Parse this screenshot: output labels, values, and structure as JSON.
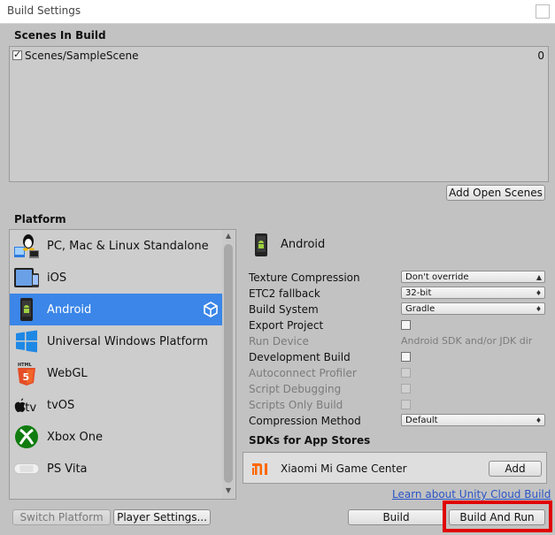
{
  "window": {
    "title": "Build Settings"
  },
  "scenes": {
    "header": "Scenes In Build",
    "items": [
      {
        "name": "Scenes/SampleScene",
        "index": "0",
        "checked": true
      }
    ],
    "add_open_scenes_label": "Add Open Scenes"
  },
  "platform": {
    "header": "Platform",
    "items": [
      {
        "label": "PC, Mac & Linux Standalone",
        "icon": "pc-mac-linux-icon"
      },
      {
        "label": "iOS",
        "icon": "ios-icon"
      },
      {
        "label": "Android",
        "icon": "android-icon",
        "selected": true
      },
      {
        "label": "Universal Windows Platform",
        "icon": "windows-icon"
      },
      {
        "label": "WebGL",
        "icon": "html5-icon"
      },
      {
        "label": "tvOS",
        "icon": "apple-tv-icon"
      },
      {
        "label": "Xbox One",
        "icon": "xbox-icon"
      },
      {
        "label": "PS Vita",
        "icon": "ps-vita-icon"
      }
    ],
    "selected_label": "Android"
  },
  "settings": {
    "texture_compression": {
      "label": "Texture Compression",
      "value": "Don't override"
    },
    "etc2_fallback": {
      "label": "ETC2 fallback",
      "value": "32-bit"
    },
    "build_system": {
      "label": "Build System",
      "value": "Gradle"
    },
    "export_project": {
      "label": "Export Project",
      "checked": false
    },
    "run_device": {
      "label": "Run Device",
      "value": "Android SDK and/or JDK dir"
    },
    "development_build": {
      "label": "Development Build",
      "checked": false
    },
    "autoconnect_profiler": {
      "label": "Autoconnect Profiler"
    },
    "script_debugging": {
      "label": "Script Debugging"
    },
    "scripts_only_build": {
      "label": "Scripts Only Build"
    },
    "compression_method": {
      "label": "Compression Method",
      "value": "Default"
    }
  },
  "sdks": {
    "header": "SDKs for App Stores",
    "items": [
      {
        "name": "Xiaomi Mi Game Center",
        "add_label": "Add"
      }
    ],
    "cloud_link": "Learn about Unity Cloud Build"
  },
  "footer": {
    "switch_platform_label": "Switch Platform",
    "player_settings_label": "Player Settings...",
    "build_label": "Build",
    "build_and_run_label": "Build And Run"
  },
  "colors": {
    "selection": "#3b86e8",
    "highlight": "#e00000",
    "background": "#c2c2c2"
  }
}
